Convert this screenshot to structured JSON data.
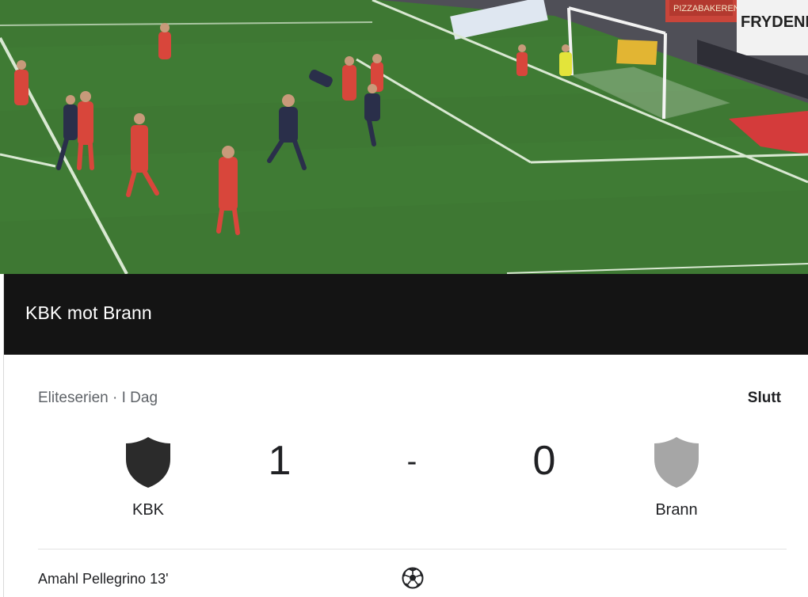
{
  "video": {
    "ad_boards": [
      "FRYDENBO",
      "PIZZABAKEREN"
    ]
  },
  "match": {
    "title": "KBK mot Brann",
    "league_date": "Eliteserien · I Dag",
    "status": "Slutt",
    "home": {
      "name": "KBK",
      "score": "1",
      "crest_color": "#2b2b2b"
    },
    "away": {
      "name": "Brann",
      "score": "0",
      "crest_color": "#a6a6a6"
    },
    "separator": "-",
    "goal_events": [
      {
        "text": "Amahl Pellegrino 13'",
        "icon": "soccer-ball-icon"
      }
    ]
  }
}
